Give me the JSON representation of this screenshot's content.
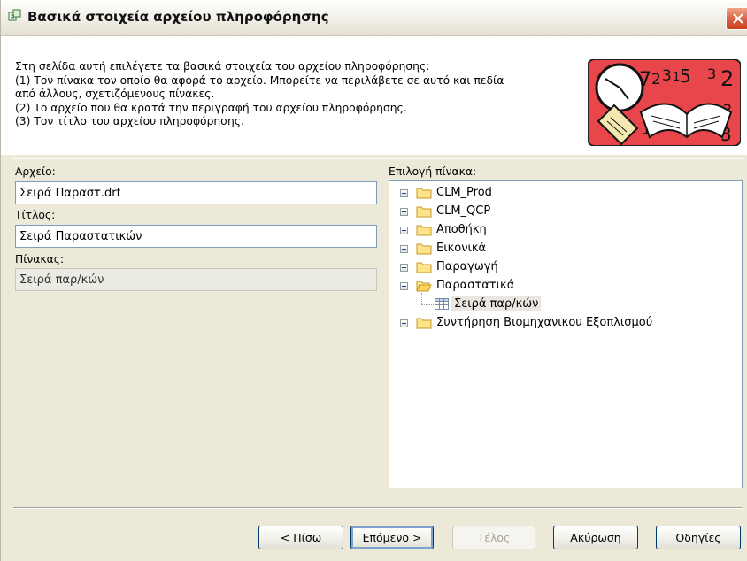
{
  "window": {
    "title": "Βασικά στοιχεία αρχείου πληροφόρησης",
    "close_glyph": "✕"
  },
  "intro": {
    "lines": [
      "Στη σελίδα αυτή επιλέγετε τα βασικά στοιχεία του αρχείου πληροφόρησης:",
      "(1) Τον πίνακα τον οποίο θα αφορά το αρχείο. Μπορείτε να περιλάβετε σε αυτό και πεδία",
      "από άλλους, σχετιζόμενους πίνακες.",
      "(2) Το αρχείο που θα κρατά την περιγραφή του αρχείου πληροφόρησης.",
      "(3) Τον τίτλο του αρχείου πληροφόρησης."
    ]
  },
  "hero": {
    "icon": "clock-book-illustration"
  },
  "form": {
    "file_label": "Αρχείο:",
    "file_value": "Σειρά Παραστ.drf",
    "title_label": "Τίτλος:",
    "title_value": "Σειρά Παραστατικών",
    "table_label": "Πίνακας:",
    "table_value": "Σειρά παρ/κών"
  },
  "tree": {
    "label": "Επιλογή πίνακα:",
    "nodes": [
      {
        "label": "CLM_Prod",
        "expanded": false
      },
      {
        "label": "CLM_QCP",
        "expanded": false
      },
      {
        "label": "Αποθήκη",
        "expanded": false
      },
      {
        "label": "Εικονικά",
        "expanded": false
      },
      {
        "label": "Παραγωγή",
        "expanded": false
      },
      {
        "label": "Παραστατικά",
        "expanded": true,
        "children": [
          {
            "label": "Σειρά παρ/κών",
            "selected": true
          }
        ]
      },
      {
        "label": "Συντήρηση Βιομηχανικου Εξοπλισμού",
        "expanded": false
      }
    ]
  },
  "buttons": {
    "back": "< Πίσω",
    "next": "Επόμενο >",
    "finish": "Τέλος",
    "cancel": "Ακύρωση",
    "help": "Οδηγίες"
  }
}
